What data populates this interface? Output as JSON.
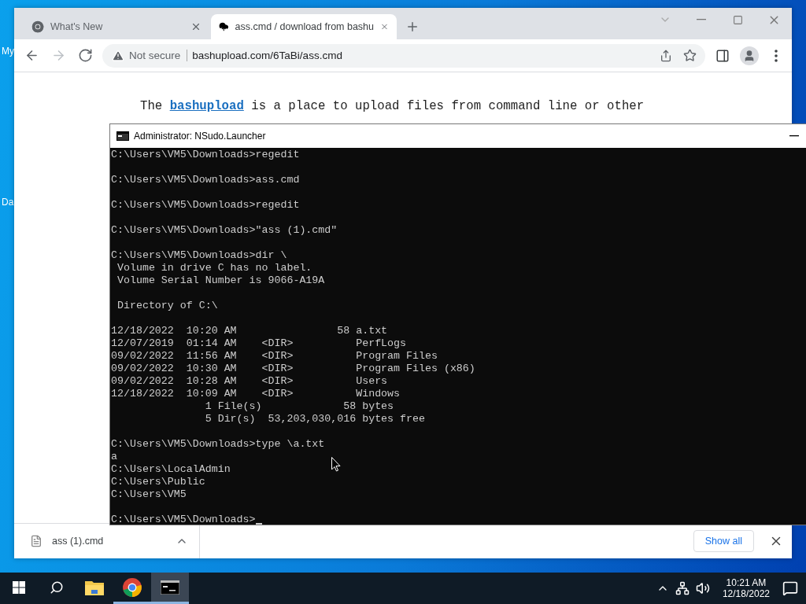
{
  "desktop": {
    "icon_labels": [
      "My",
      "Da"
    ]
  },
  "browser": {
    "tabs": [
      {
        "title": "What's New",
        "selected": false
      },
      {
        "title": "ass.cmd / download from bashu",
        "selected": true
      }
    ],
    "nav": [
      {
        "kind": "back",
        "disabled": false
      },
      {
        "kind": "forward",
        "disabled": true
      },
      {
        "kind": "reload",
        "disabled": false
      }
    ],
    "address": {
      "security": "Not secure",
      "url": "bashupload.com/6TaBi/ass.cmd"
    },
    "page": {
      "before": "The",
      "link": "bashupload",
      "after": "is a place to upload files from command line or other"
    },
    "downloads": [
      {
        "name": "ass (1).cmd"
      }
    ],
    "show_all": "Show all"
  },
  "console": {
    "title": "Administrator: NSudo.Launcher",
    "cursor": true,
    "blocks": [
      [
        "C:\\Users\\VM5\\Downloads>regedit"
      ],
      [
        "C:\\Users\\VM5\\Downloads>ass.cmd"
      ],
      [
        "C:\\Users\\VM5\\Downloads>regedit"
      ],
      [
        "C:\\Users\\VM5\\Downloads>\"ass (1).cmd\""
      ],
      [
        "C:\\Users\\VM5\\Downloads>dir \\",
        " Volume in drive C has no label.",
        " Volume Serial Number is 9066-A19A"
      ],
      [
        " Directory of C:\\"
      ],
      [
        "12/18/2022  10:20 AM                58 a.txt",
        "12/07/2019  01:14 AM    <DIR>          PerfLogs",
        "09/02/2022  11:56 AM    <DIR>          Program Files",
        "09/02/2022  10:30 AM    <DIR>          Program Files (x86)",
        "09/02/2022  10:28 AM    <DIR>          Users",
        "12/18/2022  10:09 AM    <DIR>          Windows",
        "               1 File(s)             58 bytes",
        "               5 Dir(s)  53,203,030,016 bytes free"
      ],
      [
        "C:\\Users\\VM5\\Downloads>type \\a.txt",
        "a",
        "C:\\Users\\LocalAdmin",
        "C:\\Users\\Public",
        "C:\\Users\\VM5"
      ],
      [
        "C:\\Users\\VM5\\Downloads>"
      ]
    ]
  },
  "taskbar": {
    "apps": [
      {
        "kind": "explorer",
        "running": false,
        "selected": false
      },
      {
        "kind": "chrome",
        "running": true,
        "selected": false
      },
      {
        "kind": "terminal",
        "running": true,
        "selected": true
      }
    ],
    "time": "10:21 AM",
    "date": "12/18/2022"
  }
}
